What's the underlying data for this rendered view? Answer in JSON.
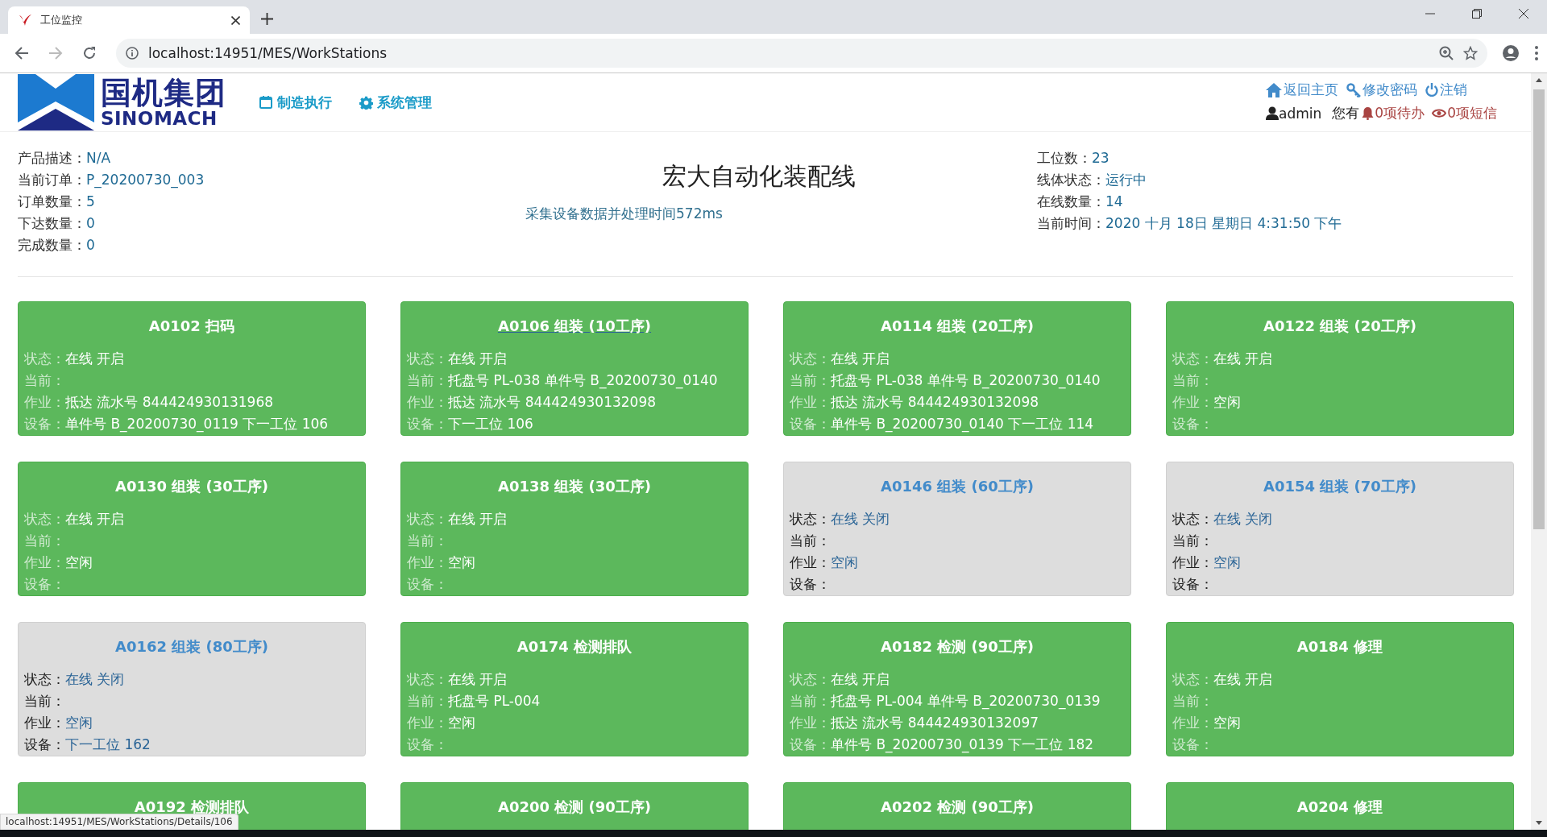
{
  "browser": {
    "tab_title": "工位监控",
    "url": "localhost:14951/MES/WorkStations",
    "status_url": "localhost:14951/MES/WorkStations/Details/106"
  },
  "header": {
    "logo_cn": "国机集团",
    "logo_en": "SINOMACH",
    "nav": [
      {
        "kind": "calendar",
        "label": "制造执行"
      },
      {
        "kind": "gear",
        "label": "系统管理"
      }
    ],
    "links": [
      {
        "kind": "home",
        "label": "返回主页"
      },
      {
        "kind": "key",
        "label": "修改密码"
      },
      {
        "kind": "power",
        "label": "注销"
      }
    ],
    "user": "admin",
    "notice": "您有",
    "todo": "0项待办",
    "sms": "0项短信"
  },
  "line": {
    "title": "宏大自动化装配线",
    "subtitle": "采集设备数据并处理时间572ms",
    "left": [
      {
        "label": "产品描述：",
        "value": "N/A"
      },
      {
        "label": "当前订单：",
        "value": "P_20200730_003"
      },
      {
        "label": "订单数量：",
        "value": "5"
      },
      {
        "label": "下达数量：",
        "value": "0"
      },
      {
        "label": "完成数量：",
        "value": "0"
      }
    ],
    "right": [
      {
        "label": "工位数：",
        "value": "23"
      },
      {
        "label": "线体状态：",
        "value": "运行中"
      },
      {
        "label": "在线数量：",
        "value": "14"
      },
      {
        "label": "当前时间：",
        "value": "2020 十月 18日 星期日 4:31:50 下午"
      }
    ]
  },
  "stations": [
    {
      "title": "A0102 扫码",
      "active": true,
      "hovered": false,
      "fields": [
        {
          "label": "状态：",
          "value": "在线 开启"
        },
        {
          "label": "当前："
        },
        {
          "label": "作业：",
          "value": "抵达 流水号 844424930131968"
        },
        {
          "label": "设备：",
          "value": "单件号 B_20200730_0119 下一工位 106"
        }
      ]
    },
    {
      "title": "A0106 组装 (10工序)",
      "active": true,
      "hovered": true,
      "fields": [
        {
          "label": "状态：",
          "value": "在线 开启"
        },
        {
          "label": "当前：",
          "value": "托盘号 PL-038 单件号 B_20200730_0140"
        },
        {
          "label": "作业：",
          "value": "抵达 流水号 844424930132098"
        },
        {
          "label": "设备：",
          "value": "下一工位 106"
        }
      ]
    },
    {
      "title": "A0114 组装 (20工序)",
      "active": true,
      "hovered": false,
      "fields": [
        {
          "label": "状态：",
          "value": "在线 开启"
        },
        {
          "label": "当前：",
          "value": "托盘号 PL-038 单件号 B_20200730_0140"
        },
        {
          "label": "作业：",
          "value": "抵达 流水号 844424930132098"
        },
        {
          "label": "设备：",
          "value": "单件号 B_20200730_0140 下一工位 114"
        }
      ]
    },
    {
      "title": "A0122 组装 (20工序)",
      "active": true,
      "hovered": false,
      "fields": [
        {
          "label": "状态：",
          "value": "在线 开启"
        },
        {
          "label": "当前："
        },
        {
          "label": "作业：",
          "value": "空闲"
        },
        {
          "label": "设备："
        }
      ]
    },
    {
      "title": "A0130 组装 (30工序)",
      "active": true,
      "hovered": false,
      "fields": [
        {
          "label": "状态：",
          "value": "在线 开启"
        },
        {
          "label": "当前："
        },
        {
          "label": "作业：",
          "value": "空闲"
        },
        {
          "label": "设备："
        }
      ]
    },
    {
      "title": "A0138 组装 (30工序)",
      "active": true,
      "hovered": false,
      "fields": [
        {
          "label": "状态：",
          "value": "在线 开启"
        },
        {
          "label": "当前："
        },
        {
          "label": "作业：",
          "value": "空闲"
        },
        {
          "label": "设备："
        }
      ]
    },
    {
      "title": "A0146 组装 (60工序)",
      "active": false,
      "hovered": false,
      "fields": [
        {
          "label": "状态：",
          "value": "在线 关闭"
        },
        {
          "label": "当前："
        },
        {
          "label": "作业：",
          "value": "空闲"
        },
        {
          "label": "设备："
        }
      ]
    },
    {
      "title": "A0154 组装 (70工序)",
      "active": false,
      "hovered": false,
      "fields": [
        {
          "label": "状态：",
          "value": "在线 关闭"
        },
        {
          "label": "当前："
        },
        {
          "label": "作业：",
          "value": "空闲"
        },
        {
          "label": "设备："
        }
      ]
    },
    {
      "title": "A0162 组装 (80工序)",
      "active": false,
      "hovered": false,
      "fields": [
        {
          "label": "状态：",
          "value": "在线 关闭"
        },
        {
          "label": "当前："
        },
        {
          "label": "作业：",
          "value": "空闲"
        },
        {
          "label": "设备：",
          "value": "下一工位 162"
        }
      ]
    },
    {
      "title": "A0174 检测排队",
      "active": true,
      "hovered": false,
      "fields": [
        {
          "label": "状态：",
          "value": "在线 开启"
        },
        {
          "label": "当前：",
          "value": "托盘号 PL-004"
        },
        {
          "label": "作业：",
          "value": "空闲"
        },
        {
          "label": "设备："
        }
      ]
    },
    {
      "title": "A0182 检测 (90工序)",
      "active": true,
      "hovered": false,
      "fields": [
        {
          "label": "状态：",
          "value": "在线 开启"
        },
        {
          "label": "当前：",
          "value": "托盘号 PL-004 单件号 B_20200730_0139"
        },
        {
          "label": "作业：",
          "value": "抵达 流水号 844424930132097"
        },
        {
          "label": "设备：",
          "value": "单件号 B_20200730_0139 下一工位 182"
        }
      ]
    },
    {
      "title": "A0184 修理",
      "active": true,
      "hovered": false,
      "fields": [
        {
          "label": "状态：",
          "value": "在线 开启"
        },
        {
          "label": "当前："
        },
        {
          "label": "作业：",
          "value": "空闲"
        },
        {
          "label": "设备："
        }
      ]
    },
    {
      "title": "A0192 检测排队",
      "active": true,
      "hovered": false
    },
    {
      "title": "A0200 检测 (90工序)",
      "active": true,
      "hovered": false
    },
    {
      "title": "A0202 检测 (90工序)",
      "active": true,
      "hovered": false
    },
    {
      "title": "A0204 修理",
      "active": true,
      "hovered": false
    }
  ]
}
